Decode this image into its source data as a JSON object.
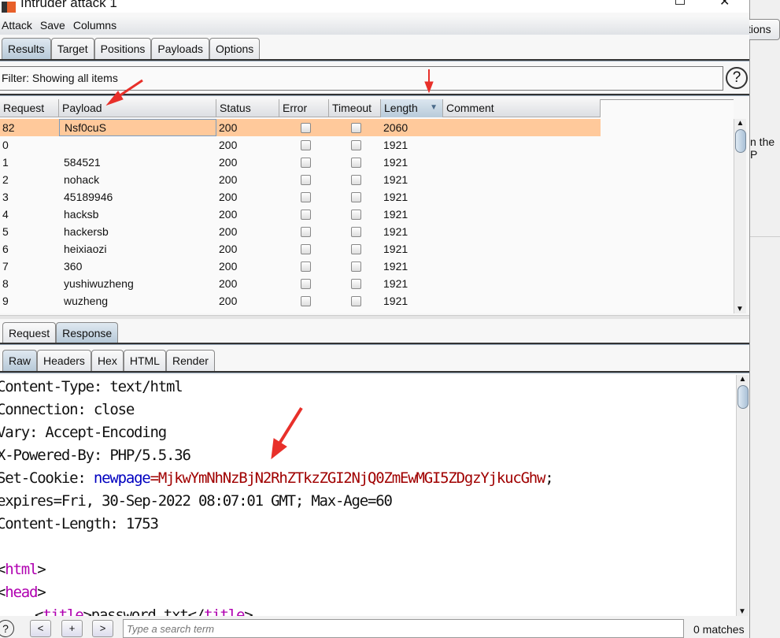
{
  "window": {
    "title": "Intruder attack 1"
  },
  "background_app": {
    "tab_fragment": "tions",
    "text_fragment": "n the P"
  },
  "menu": [
    "Attack",
    "Save",
    "Columns"
  ],
  "tabs": [
    "Results",
    "Target",
    "Positions",
    "Payloads",
    "Options"
  ],
  "filter": "Filter: Showing all items",
  "table": {
    "columns": [
      "Request",
      "Payload",
      "Status",
      "Error",
      "Timeout",
      "Length",
      "Comment"
    ],
    "sorted_column": "Length",
    "rows": [
      {
        "request": "82",
        "payload": "Nsf0cuS",
        "status": "200",
        "length": "2060",
        "selected": true
      },
      {
        "request": "0",
        "payload": "",
        "status": "200",
        "length": "1921"
      },
      {
        "request": "1",
        "payload": "584521",
        "status": "200",
        "length": "1921"
      },
      {
        "request": "2",
        "payload": "nohack",
        "status": "200",
        "length": "1921"
      },
      {
        "request": "3",
        "payload": "45189946",
        "status": "200",
        "length": "1921"
      },
      {
        "request": "4",
        "payload": "hacksb",
        "status": "200",
        "length": "1921"
      },
      {
        "request": "5",
        "payload": "hackersb",
        "status": "200",
        "length": "1921"
      },
      {
        "request": "6",
        "payload": "heixiaozi",
        "status": "200",
        "length": "1921"
      },
      {
        "request": "7",
        "payload": "360",
        "status": "200",
        "length": "1921"
      },
      {
        "request": "8",
        "payload": "yushiwuzheng",
        "status": "200",
        "length": "1921"
      },
      {
        "request": "9",
        "payload": "wuzheng",
        "status": "200",
        "length": "1921"
      }
    ]
  },
  "reqres_tabs": [
    "Request",
    "Response"
  ],
  "view_tabs": [
    "Raw",
    "Headers",
    "Hex",
    "HTML",
    "Render"
  ],
  "response": {
    "lines": [
      "Content-Type: text/html",
      "Connection: close",
      "Vary: Accept-Encoding",
      "X-Powered-By: PHP/5.5.36"
    ],
    "cookie_label": "Set-Cookie: ",
    "cookie_name": "newpage",
    "cookie_eq": "=",
    "cookie_value": "MjkwYmNhNzBjN2RhZTkzZGI2NjQ0ZmEwMGI5ZDgzYjkucGhw",
    "cookie_end": ";",
    "lines2": [
      "expires=Fri, 30-Sep-2022 08:07:01 GMT; Max-Age=60",
      "Content-Length: 1753"
    ],
    "html_open": "<",
    "html_tag": "html",
    "html_close": ">",
    "head_tag": "head",
    "title_tag": "title",
    "title_text": "password.txt",
    "title_end": "</"
  },
  "search": {
    "placeholder": "Type a search term",
    "prev": "<",
    "add": "+",
    "next": ">",
    "matches": "0 matches"
  },
  "colors": {
    "selected_row": "#ffc99b",
    "cookie_name": "#0000c0",
    "cookie_value": "#a00000",
    "tag": "#b000b0",
    "annotation": "#e8302a"
  }
}
